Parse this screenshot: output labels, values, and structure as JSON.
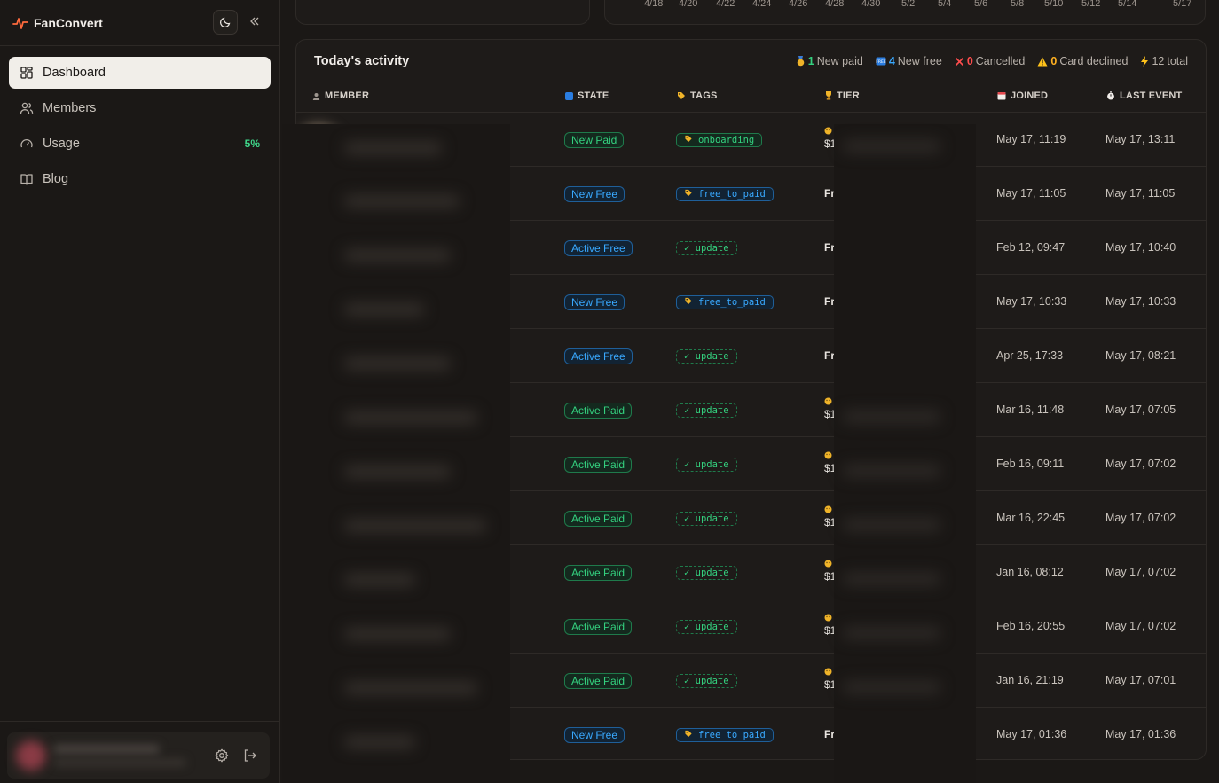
{
  "app": {
    "name": "FanConvert",
    "accent": "#ff6a3d"
  },
  "sidebar": {
    "items": [
      {
        "label": "Dashboard",
        "icon": "dashboard-icon",
        "active": true
      },
      {
        "label": "Members",
        "icon": "members-icon",
        "active": false
      },
      {
        "label": "Usage",
        "icon": "gauge-icon",
        "active": false,
        "badge": "5%"
      },
      {
        "label": "Blog",
        "icon": "book-icon",
        "active": false
      }
    ]
  },
  "chart_strip": {
    "x_ticks": [
      "4/18",
      "4/20",
      "4/22",
      "4/24",
      "4/26",
      "4/28",
      "4/30",
      "5/2",
      "5/4",
      "5/6",
      "5/8",
      "5/10",
      "5/12",
      "5/14",
      "5/17"
    ]
  },
  "activity": {
    "title": "Today's activity",
    "summary": [
      {
        "count": "1",
        "label": "New paid",
        "color": "#34d17f",
        "icon": "medal-icon"
      },
      {
        "count": "4",
        "label": "New free",
        "color": "#39a9ff",
        "icon": "free-icon"
      },
      {
        "count": "0",
        "label": "Cancelled",
        "color": "#ff4d4d",
        "icon": "x-icon"
      },
      {
        "count": "0",
        "label": "Card declined",
        "color": "#ffb020",
        "icon": "warning-icon"
      },
      {
        "count": "12",
        "label": "total",
        "color": "#b8b1aa",
        "icon": "bolt-icon"
      }
    ],
    "columns": [
      "MEMBER",
      "STATE",
      "TAGS",
      "TIER",
      "JOINED",
      "LAST EVENT"
    ],
    "rows": [
      {
        "state": "New Paid",
        "state_kind": "paid",
        "tag": "onboarding",
        "tag_kind": "onboard",
        "tier": "$1",
        "joined": "May 17, 11:19",
        "last_event": "May 17, 13:11",
        "avatar": "#8a7a68"
      },
      {
        "state": "New Free",
        "state_kind": "free",
        "tag": "free_to_paid",
        "tag_kind": "ftp",
        "tier": "Fr",
        "joined": "May 17, 11:05",
        "last_event": "May 17, 11:05",
        "avatar": "#b26a1e"
      },
      {
        "state": "Active Free",
        "state_kind": "free",
        "tag": "✓ update",
        "tag_kind": "upd",
        "tier": "Fr",
        "joined": "Feb 12, 09:47",
        "last_event": "May 17, 10:40",
        "avatar": "#1e8a5a"
      },
      {
        "state": "New Free",
        "state_kind": "free",
        "tag": "free_to_paid",
        "tag_kind": "ftp",
        "tier": "Fr",
        "joined": "May 17, 10:33",
        "last_event": "May 17, 10:33",
        "avatar": "#7a6a78"
      },
      {
        "state": "Active Free",
        "state_kind": "free",
        "tag": "✓ update",
        "tag_kind": "upd",
        "tier": "Fr",
        "joined": "Apr 25, 17:33",
        "last_event": "May 17, 08:21",
        "avatar": "#b03a3a"
      },
      {
        "state": "Active Paid",
        "state_kind": "paid",
        "tag": "✓ update",
        "tag_kind": "upd",
        "tier": "$1",
        "joined": "Mar 16, 11:48",
        "last_event": "May 17, 07:05",
        "avatar": "#168a88"
      },
      {
        "state": "Active Paid",
        "state_kind": "paid",
        "tag": "✓ update",
        "tag_kind": "upd",
        "tier": "$1",
        "joined": "Feb 16, 09:11",
        "last_event": "May 17, 07:02",
        "avatar": "#5a3a36"
      },
      {
        "state": "Active Paid",
        "state_kind": "paid",
        "tag": "✓ update",
        "tag_kind": "upd",
        "tier": "$1",
        "joined": "Mar 16, 22:45",
        "last_event": "May 17, 07:02",
        "avatar": "#a8a4a0"
      },
      {
        "state": "Active Paid",
        "state_kind": "paid",
        "tag": "✓ update",
        "tag_kind": "upd",
        "tier": "$1",
        "joined": "Jan 16, 08:12",
        "last_event": "May 17, 07:02",
        "avatar": "#2a6ab0"
      },
      {
        "state": "Active Paid",
        "state_kind": "paid",
        "tag": "✓ update",
        "tag_kind": "upd",
        "tier": "$1",
        "joined": "Feb 16, 20:55",
        "last_event": "May 17, 07:02",
        "avatar": "#3a4a90"
      },
      {
        "state": "Active Paid",
        "state_kind": "paid",
        "tag": "✓ update",
        "tag_kind": "upd",
        "tier": "$1",
        "joined": "Jan 16, 21:19",
        "last_event": "May 17, 07:01",
        "avatar": "#1e7a52"
      },
      {
        "state": "New Free",
        "state_kind": "free",
        "tag": "free_to_paid",
        "tag_kind": "ftp",
        "tier": "Fr",
        "joined": "May 17, 01:36",
        "last_event": "May 17, 01:36",
        "avatar": "#c0402a"
      }
    ]
  }
}
